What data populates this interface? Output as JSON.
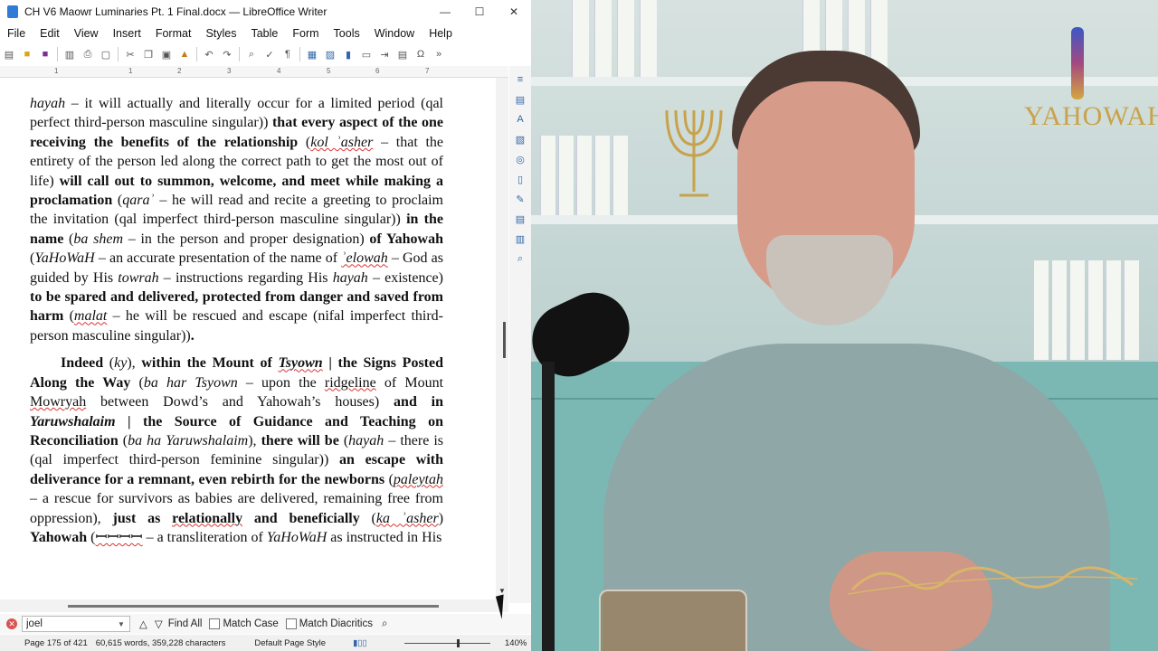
{
  "window": {
    "title": "CH V6 Maowr Luminaries Pt. 1 Final.docx — LibreOffice Writer",
    "controls": [
      "—",
      "☐",
      "✕"
    ]
  },
  "menubar": [
    "File",
    "Edit",
    "View",
    "Insert",
    "Format",
    "Styles",
    "Table",
    "Form",
    "Tools",
    "Window",
    "Help"
  ],
  "ruler": {
    "marks": [
      "1",
      "1",
      "2",
      "3",
      "4",
      "5",
      "6",
      "7"
    ]
  },
  "document": {
    "paragraphs": [
      {
        "style": "plain",
        "runs": [
          {
            "t": "hayah",
            "i": true
          },
          {
            "t": " – it will actually and literally occur for a limited period (qal perfect third-person masculine singular)) "
          },
          {
            "t": "that every aspect of the one receiving the benefits of the relationship",
            "b": true
          },
          {
            "t": " ("
          },
          {
            "t": "kol ʾasher",
            "i": true,
            "sp": true
          },
          {
            "t": " – that the entirety of the person led along the correct path to get the most out of life) "
          },
          {
            "t": "will call out to summon, welcome, and meet while making a proclamation",
            "b": true
          },
          {
            "t": " ("
          },
          {
            "t": "qaraʾ",
            "i": true
          },
          {
            "t": " – he will read and recite a greeting to proclaim the invitation (qal imperfect third-person masculine singular)) "
          },
          {
            "t": "in the name",
            "b": true
          },
          {
            "t": " ("
          },
          {
            "t": "ba shem",
            "i": true
          },
          {
            "t": " – in the person and proper designation) "
          },
          {
            "t": "of Yahowah",
            "b": true
          },
          {
            "t": " ("
          },
          {
            "t": "YaHoWaH",
            "i": true
          },
          {
            "t": " – an accurate presentation of the name of "
          },
          {
            "t": "ʾelowah",
            "i": true,
            "sp": true
          },
          {
            "t": " – God as guided by His "
          },
          {
            "t": "towrah",
            "i": true
          },
          {
            "t": " – instructions regarding His "
          },
          {
            "t": "hayah",
            "i": true
          },
          {
            "t": " – existence) "
          },
          {
            "t": "to be spared and delivered, protected from danger and saved from harm",
            "b": true
          },
          {
            "t": " ("
          },
          {
            "t": "malat",
            "i": true,
            "sp": true
          },
          {
            "t": " – he will be rescued and escape (nifal imperfect third-person masculine singular))"
          },
          {
            "t": ".",
            "b": true
          }
        ]
      },
      {
        "style": "indent",
        "runs": [
          {
            "t": "Indeed",
            "b": true
          },
          {
            "t": " ("
          },
          {
            "t": "ky",
            "i": true
          },
          {
            "t": "), "
          },
          {
            "t": "within the Mount of ",
            "b": true
          },
          {
            "t": "Tsyown",
            "b": true,
            "i": true,
            "sp": true
          },
          {
            "t": " | the Signs Posted Along the Way",
            "b": true
          },
          {
            "t": " ("
          },
          {
            "t": "ba har Tsyown",
            "i": true
          },
          {
            "t": " – upon the "
          },
          {
            "t": "ridgeline",
            "sp": true
          },
          {
            "t": " of Mount "
          },
          {
            "t": "Mowryah",
            "sp": true
          },
          {
            "t": " between Dowd’s and Yahowah’s houses) "
          },
          {
            "t": "and in ",
            "b": true
          },
          {
            "t": "Yaruwshalaim",
            "b": true,
            "i": true
          },
          {
            "t": " | the Source of Guidance and Teaching on Reconciliation",
            "b": true
          },
          {
            "t": "  ("
          },
          {
            "t": "ba ha Yaruwshalaim",
            "i": true
          },
          {
            "t": "), "
          },
          {
            "t": "there will be",
            "b": true
          },
          {
            "t": " ("
          },
          {
            "t": "hayah",
            "i": true
          },
          {
            "t": " – there is (qal imperfect third-person feminine singular)) "
          },
          {
            "t": "an escape with deliverance for a remnant, even rebirth for the newborns",
            "b": true
          },
          {
            "t": " ("
          },
          {
            "t": "paleytah",
            "i": true,
            "sp": true
          },
          {
            "t": " – a rescue for survivors as babies are delivered, remaining free from oppression), "
          },
          {
            "t": "just as ",
            "b": true
          },
          {
            "t": "relationally",
            "b": true,
            "sp": true
          },
          {
            "t": " and beneficially",
            "b": true
          },
          {
            "t": " ("
          },
          {
            "t": "ka ʾasher",
            "i": true,
            "sp": true
          },
          {
            "t": ") "
          },
          {
            "t": "Yahowah",
            "b": true
          },
          {
            "t": " ("
          },
          {
            "t": "ꟷꟷꟷꟷ",
            "sp": true
          },
          {
            "t": " – a transliteration of "
          },
          {
            "t": "YaHoWaH",
            "i": true
          },
          {
            "t": " as instructed in His"
          }
        ]
      }
    ]
  },
  "findbar": {
    "query": "joel",
    "find_all": "Find All",
    "match_case": "Match Case",
    "match_diacritics": "Match Diacritics"
  },
  "statusbar": {
    "page": "Page 175 of 421",
    "counts": "60,615 words, 359,228 characters",
    "page_style": "Default Page Style",
    "zoom": "140%"
  },
  "video": {
    "brand": "YAHOWAH",
    "signature": "Craig Winn"
  },
  "colors": {
    "accent_blue": "#0a63c9",
    "brand_gold": "#c9a24a"
  }
}
